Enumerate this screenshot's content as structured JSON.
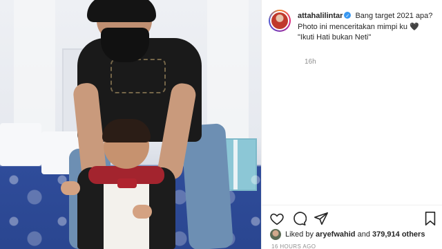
{
  "post": {
    "username": "attahalilintar",
    "caption_lines": [
      "Bang target 2021 apa?",
      "Photo ini menceritakan mimpi ku",
      "\"Ikuti Hati bukan Neti\""
    ],
    "caption_emoji": "🖤",
    "relative_time": "16h"
  },
  "likes": {
    "prefix": "Liked by",
    "user": "aryefwahid",
    "conjunction": "and",
    "count": "379,914 others"
  },
  "timestamp": "16 HOURS AGO",
  "icons": {
    "like": "heart-outline-icon",
    "comment": "comment-bubble-icon",
    "share": "paper-plane-icon",
    "save": "bookmark-icon"
  },
  "colors": {
    "text": "#262626",
    "muted": "#8e8e8e",
    "verified": "#3897f0"
  }
}
